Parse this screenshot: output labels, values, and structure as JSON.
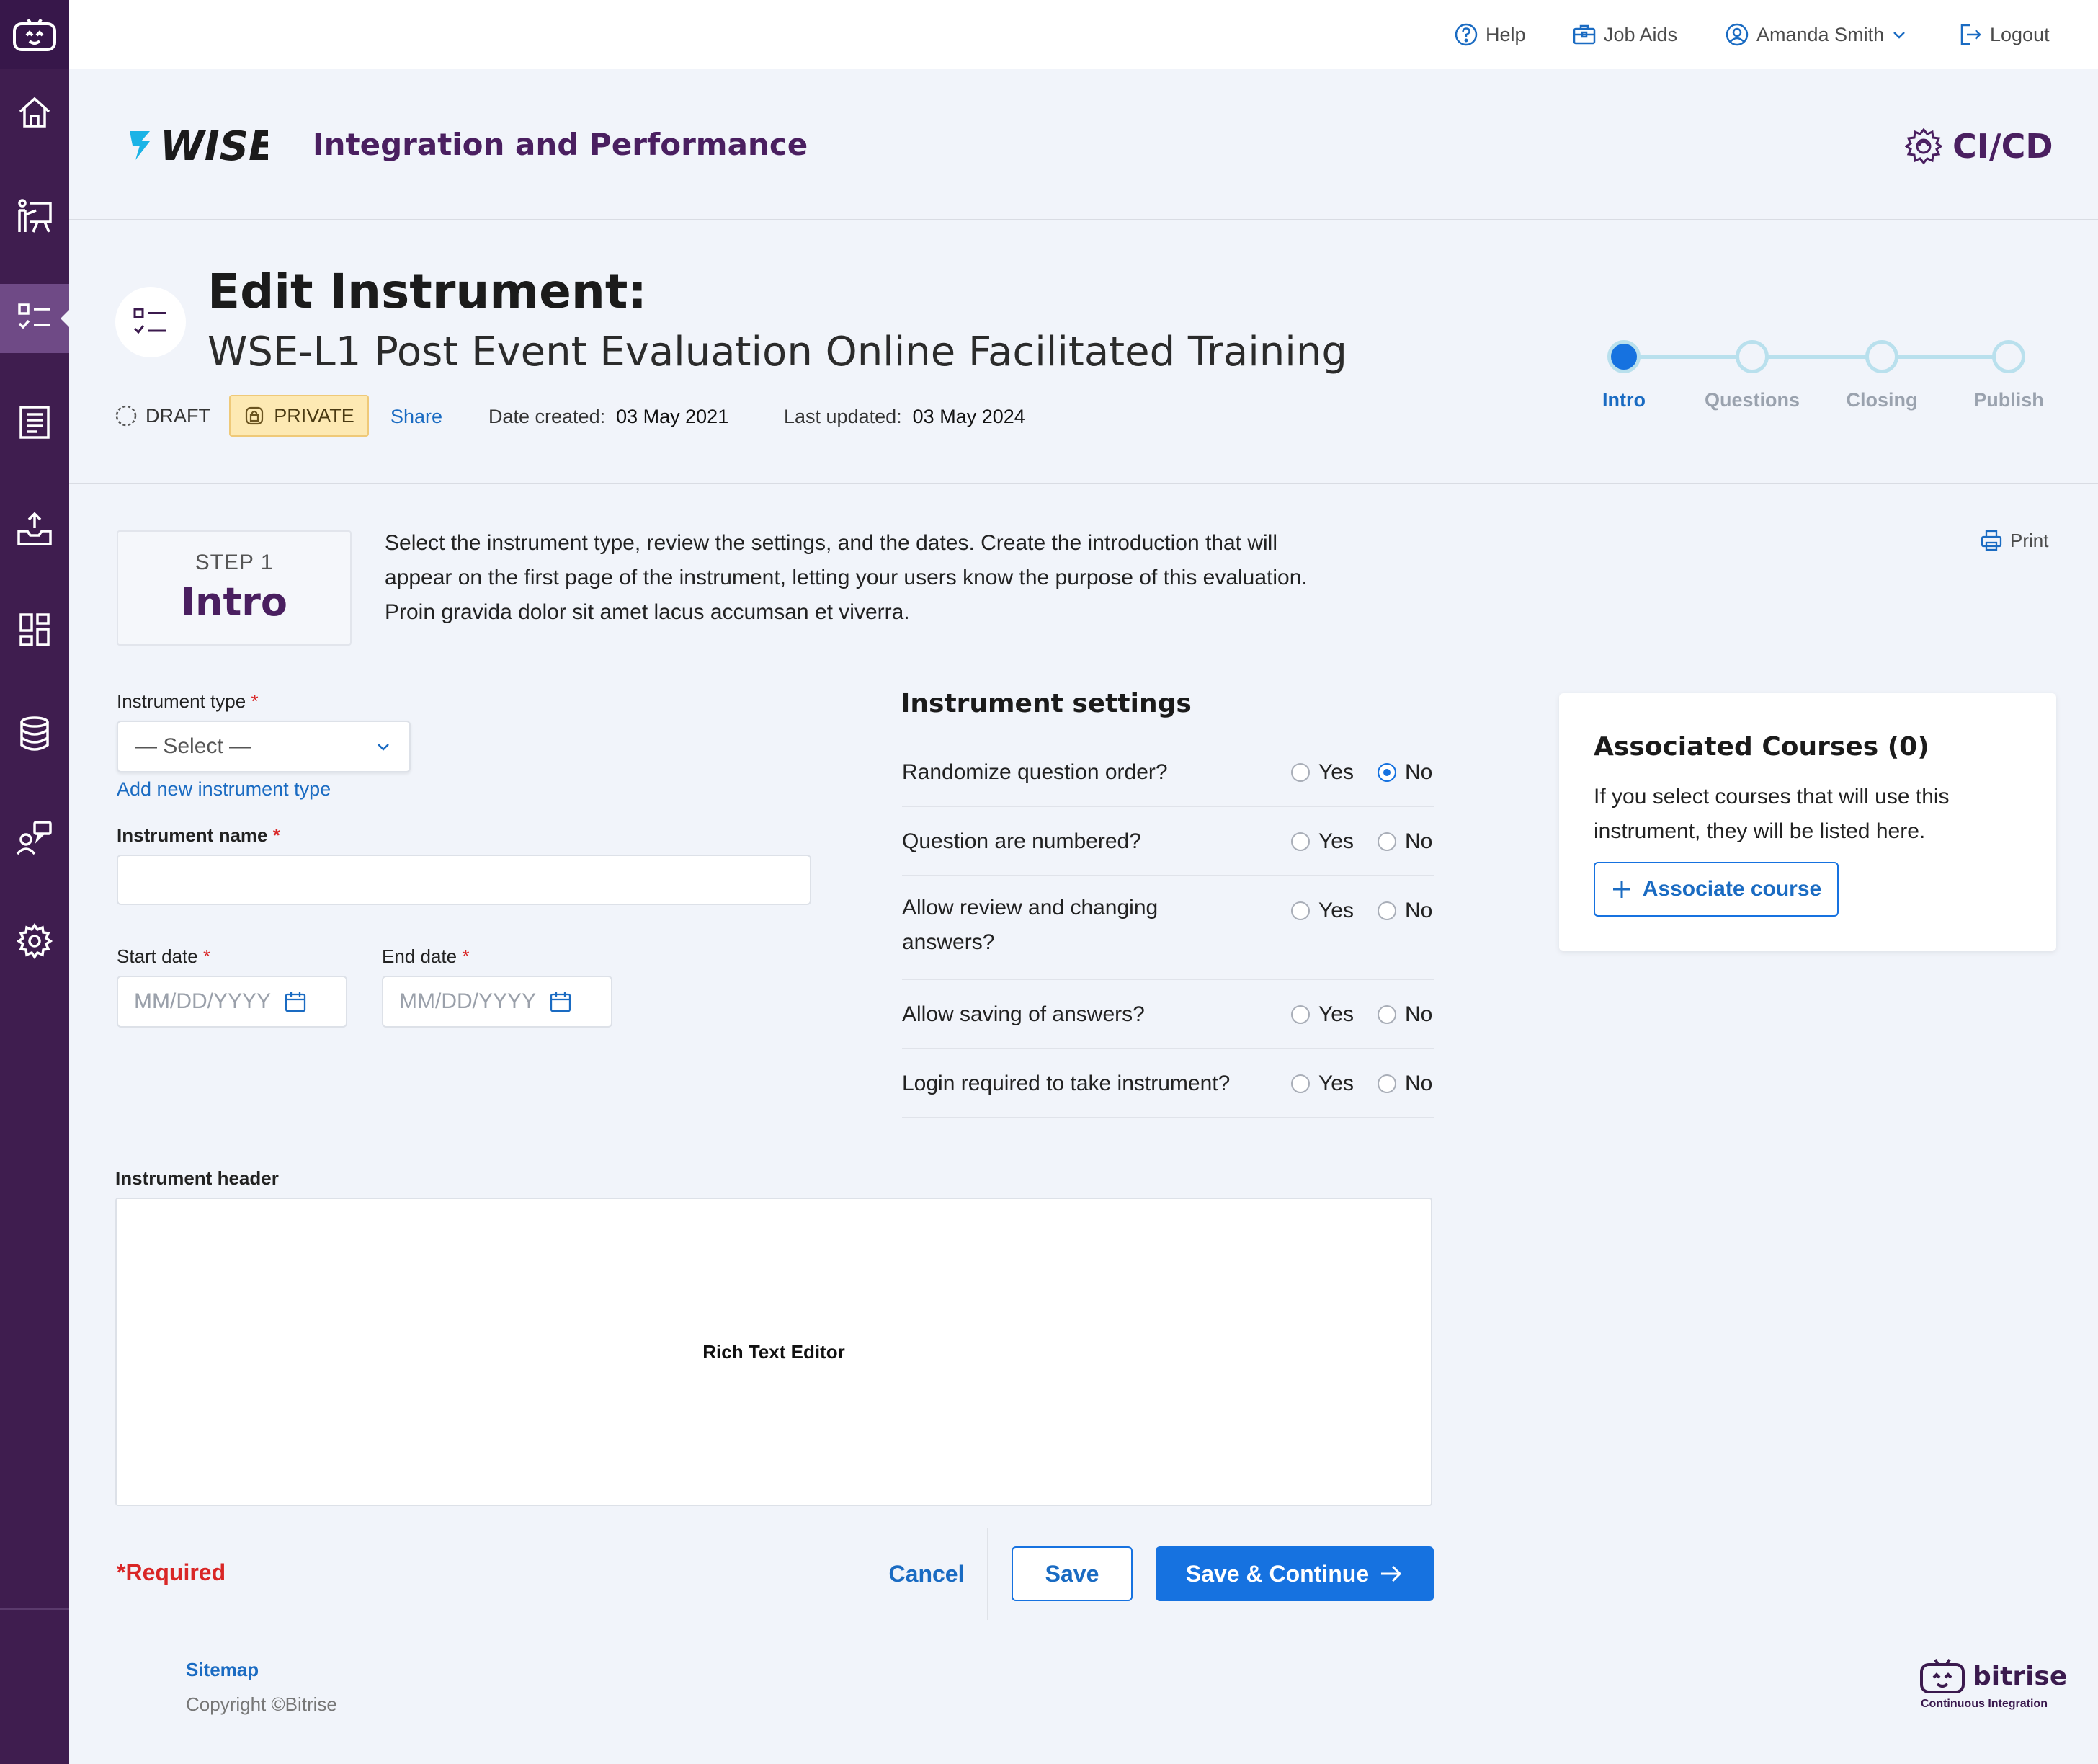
{
  "topbar": {
    "help": "Help",
    "job_aids": "Job Aids",
    "user_name": "Amanda Smith",
    "logout": "Logout"
  },
  "header": {
    "logo_text": "WISE",
    "app_title": "Integration and Performance",
    "module": "CI/CD"
  },
  "page": {
    "title": "Edit Instrument:",
    "subtitle": "WSE-L1 Post Event Evaluation Online Facilitated Training",
    "status": "DRAFT",
    "visibility": "PRIVATE",
    "share": "Share",
    "date_created_label": "Date created:",
    "date_created": "03 May 2021",
    "last_updated_label": "Last updated:",
    "last_updated": "03 May 2024"
  },
  "stepper": {
    "steps": [
      "Intro",
      "Questions",
      "Closing",
      "Publish"
    ],
    "current_index": 0
  },
  "step": {
    "label": "STEP 1",
    "name": "Intro",
    "description_lines": [
      "Select the instrument type, review the settings, and the dates. Create the introduction that will",
      "appear on the first page of the instrument, letting your users know the purpose of this evaluation.",
      "Proin gravida dolor sit amet lacus accumsan et viverra."
    ],
    "print": "Print"
  },
  "form": {
    "instrument_type_label": "Instrument type",
    "instrument_type_placeholder": "— Select —",
    "add_type_link": "Add new instrument type",
    "instrument_name_label": "Instrument name",
    "instrument_name_value": "",
    "start_date_label": "Start date",
    "end_date_label": "End date",
    "date_placeholder": "MM/DD/YYYY",
    "required_mark": "*",
    "header_label": "Instrument header",
    "editor_placeholder": "Rich Text Editor",
    "required_note": "*Required"
  },
  "settings": {
    "title": "Instrument settings",
    "yes": "Yes",
    "no": "No",
    "rows": [
      {
        "q1": "Randomize question order?",
        "q2": "",
        "value": "No"
      },
      {
        "q1": "Question are numbered?",
        "q2": "",
        "value": ""
      },
      {
        "q1": "Allow review and changing",
        "q2": "answers?",
        "value": ""
      },
      {
        "q1": "Allow saving of answers?",
        "q2": "",
        "value": ""
      },
      {
        "q1": "Login required to take instrument?",
        "q2": "",
        "value": ""
      }
    ]
  },
  "associated": {
    "title": "Associated Courses (0)",
    "line1": "If you select courses that will use this",
    "line2": "instrument, they will be listed here.",
    "button": "Associate course"
  },
  "actions": {
    "cancel": "Cancel",
    "save": "Save",
    "save_continue": "Save & Continue"
  },
  "footer": {
    "sitemap": "Sitemap",
    "copyright": "Copyright ©Bitrise",
    "brand": "bitrise",
    "brand_tagline": "Continuous Integration"
  },
  "colors": {
    "sidebar": "#3f1d4f",
    "accent": "#1672e0",
    "brand_purple": "#4a1f60",
    "private_badge_bg": "#fde9b3"
  }
}
